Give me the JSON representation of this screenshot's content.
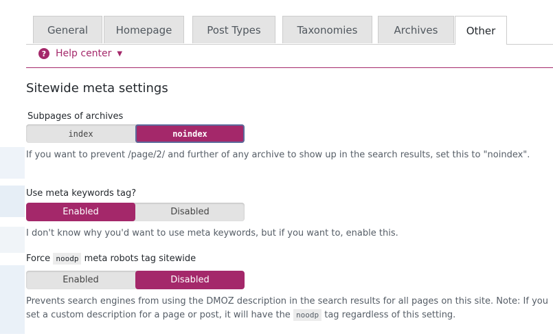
{
  "tabs": [
    {
      "label": "General"
    },
    {
      "label": "Homepage"
    },
    {
      "label": "Post Types"
    },
    {
      "label": "Taxonomies"
    },
    {
      "label": "Archives"
    },
    {
      "label": "Other",
      "active": true
    }
  ],
  "help": {
    "label": "Help center",
    "icon": "question-icon"
  },
  "section_title": "Sitewide meta settings",
  "settings": {
    "subpages": {
      "label": "Subpages of archives",
      "options": [
        "index",
        "noindex"
      ],
      "selected": "noindex",
      "description": "If you want to prevent /page/2/ and further of any archive to show up in the search results, set this to \"noindex\"."
    },
    "keywords": {
      "label": "Use meta keywords tag?",
      "options": [
        "Enabled",
        "Disabled"
      ],
      "selected": "Enabled",
      "description": "I don't know why you'd want to use meta keywords, but if you want to, enable this."
    },
    "noodp": {
      "label_prefix": "Force",
      "label_code": "noodp",
      "label_suffix": "meta robots tag sitewide",
      "options": [
        "Enabled",
        "Disabled"
      ],
      "selected": "Disabled",
      "description_before": "Prevents search engines from using the DMOZ description in the search results for all pages on this site. Note: If you set a custom description for a page or post, it will have the",
      "description_code": "noodp",
      "description_after": "tag regardless of this setting."
    }
  },
  "colors": {
    "accent": "#a4286a",
    "toggle_bg": "#e3e3e3"
  }
}
